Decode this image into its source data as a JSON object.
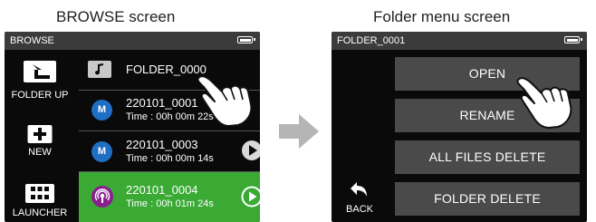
{
  "left_caption": "BROWSE screen",
  "right_caption": "Folder menu screen",
  "browse": {
    "status_title": "BROWSE",
    "side_buttons": [
      {
        "label": "FOLDER UP"
      },
      {
        "label": "NEW"
      },
      {
        "label": "LAUNCHER"
      }
    ],
    "folder_row": {
      "name": "FOLDER_0000"
    },
    "files": [
      {
        "name": "220101_0001",
        "time": "Time : 00h 00m 22s",
        "badge": "M"
      },
      {
        "name": "220101_0003",
        "time": "Time : 00h 00m 14s",
        "badge": "M"
      },
      {
        "name": "220101_0004",
        "time": "Time : 00h 01m 24s",
        "badge": "podcast-icon"
      }
    ],
    "highlight_color": "#3aaa35"
  },
  "folder_menu": {
    "status_title": "FOLDER_0001",
    "buttons": [
      "OPEN",
      "RENAME",
      "ALL FILES DELETE",
      "FOLDER DELETE"
    ],
    "back_label": "BACK"
  },
  "colors": {
    "badge_blue": "#1f6fc4",
    "button_grey": "#4a4a4a",
    "arrow_grey": "#b5b5b5"
  }
}
